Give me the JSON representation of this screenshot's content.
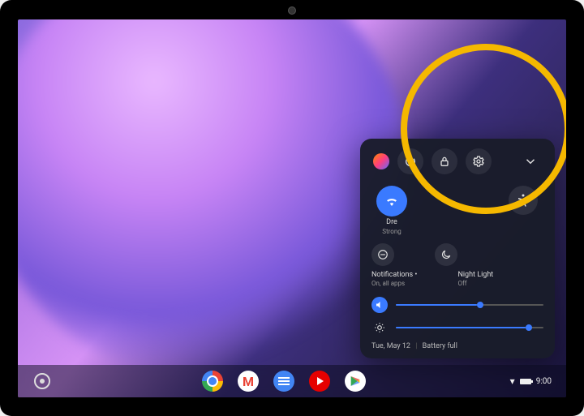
{
  "quick_settings": {
    "power_tooltip": "Power",
    "lock_tooltip": "Lock",
    "settings_tooltip": "Settings",
    "collapse_tooltip": "Collapse",
    "accessibility_tooltip": "Accessibility",
    "wifi": {
      "label": "Dre",
      "sub": "Strong"
    },
    "dnd_icon": "do-not-disturb",
    "night_light_icon": "night-light",
    "notifications": {
      "label": "Notifications  •",
      "sub": "On, all apps"
    },
    "night_light": {
      "label": "Night Light",
      "sub": "Off"
    },
    "volume_pct": 55,
    "brightness_pct": 88,
    "date": "Tue, May 12",
    "battery": "Battery full"
  },
  "tray": {
    "time": "9:00"
  },
  "shelf_icons": [
    "chrome",
    "gmail",
    "docs",
    "youtube",
    "play-store"
  ]
}
